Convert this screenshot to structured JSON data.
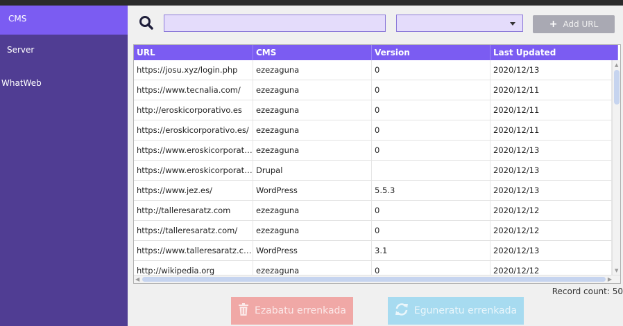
{
  "sidebar": {
    "items": [
      {
        "label": "CMS",
        "active": true
      },
      {
        "label": "Server",
        "active": false
      },
      {
        "label": "WhatWeb",
        "active": false
      }
    ]
  },
  "toolbar": {
    "search_value": "",
    "search_icon": "search-icon",
    "select_value": "",
    "add_label": "Add URL"
  },
  "table": {
    "headers": [
      "URL",
      "CMS",
      "Version",
      "Last Updated"
    ],
    "rows": [
      [
        "https://josu.xyz/login.php",
        "ezezaguna",
        "0",
        "2020/12/13"
      ],
      [
        "https://www.tecnalia.com/",
        "ezezaguna",
        "0",
        "2020/12/11"
      ],
      [
        "http://eroskicorporativo.es",
        "ezezaguna",
        "0",
        "2020/12/11"
      ],
      [
        "https://eroskicorporativo.es/",
        "ezezaguna",
        "0",
        "2020/12/11"
      ],
      [
        "https://www.eroskicorporativo...",
        "ezezaguna",
        "0",
        "2020/12/13"
      ],
      [
        "https://www.eroskicorporativo...",
        "Drupal",
        "",
        "2020/12/13"
      ],
      [
        "https://www.jez.es/",
        "WordPress",
        "5.5.3",
        "2020/12/13"
      ],
      [
        "http://talleresaratz.com",
        "ezezaguna",
        "0",
        "2020/12/12"
      ],
      [
        "https://talleresaratz.com/",
        "ezezaguna",
        "0",
        "2020/12/12"
      ],
      [
        "https://www.talleresaratz.com/",
        "WordPress",
        "3.1",
        "2020/12/13"
      ],
      [
        "http://wikipedia.org",
        "ezezaguna",
        "0",
        "2020/12/12"
      ]
    ]
  },
  "footer": {
    "record_count": "Record count: 50",
    "delete_label": "Ezabatu errenkada",
    "refresh_label": "Eguneratu errenkada"
  },
  "colors": {
    "sidebar_bg": "#503d93",
    "accent": "#7b5cf2",
    "delete_bg": "#f0a8a6",
    "refresh_bg": "#a7dbf0"
  }
}
